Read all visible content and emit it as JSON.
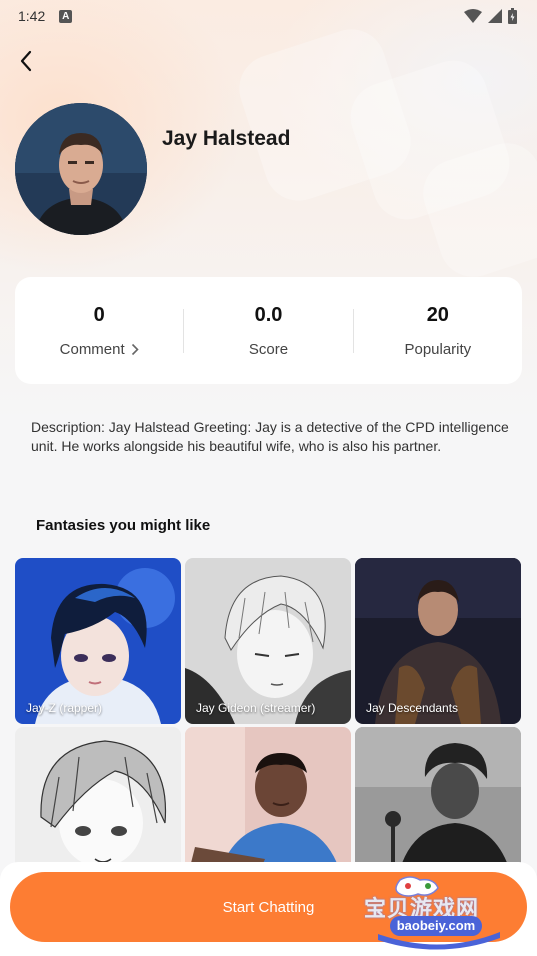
{
  "status_bar": {
    "time": "1:42",
    "notification_letter": "A"
  },
  "character": {
    "name": "Jay Halstead"
  },
  "stats": [
    {
      "value": "0",
      "label": "Comment",
      "has_chevron": true
    },
    {
      "value": "0.0",
      "label": "Score",
      "has_chevron": false
    },
    {
      "value": "20",
      "label": "Popularity",
      "has_chevron": false
    }
  ],
  "description": "Description: Jay Halstead Greeting: Jay is a detective of the CPD intelligence unit. He works alongside his beautiful wife, who is also his partner.",
  "section_title": "Fantasies you might like",
  "fantasies": [
    {
      "title": "Jay-Z (rapper)"
    },
    {
      "title": "Jay Gideon (streamer)"
    },
    {
      "title": "Jay Descendants"
    },
    {
      "title": ""
    },
    {
      "title": ""
    },
    {
      "title": ""
    }
  ],
  "start_button": {
    "label": "Start Chatting"
  },
  "watermark": {
    "text": "宝贝游戏网",
    "url": "baobeiy.com"
  },
  "colors": {
    "accent": "#fd7d33",
    "background": "#f6f6f7"
  },
  "icons": {
    "back": "back-arrow-icon",
    "chevron": "chevron-right-icon"
  }
}
